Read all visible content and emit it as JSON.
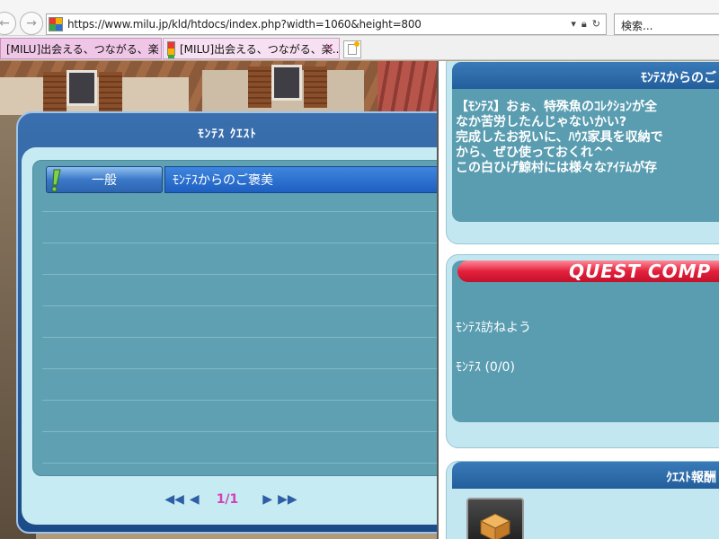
{
  "browser": {
    "url": "https://www.milu.jp/kld/htdocs/index.php?width=1060&height=800",
    "search_placeholder": "検索...",
    "tabs": [
      {
        "label": "[MILU]出会える、つながる、楽しめ..."
      },
      {
        "label": "[MILU]出会える、つながる、楽..."
      }
    ],
    "close_glyph": "×"
  },
  "quest_window": {
    "title": "ﾓﾝﾃｽ ｸｴｽﾄ",
    "items": [
      {
        "category": "一般",
        "name": "ﾓﾝﾃｽからのご褒美"
      }
    ],
    "pager": {
      "first": "◀◀",
      "prev": "◀",
      "page": "1/1",
      "next": "▶",
      "last": "▶▶"
    }
  },
  "dialog": {
    "title": "ﾓﾝﾃｽからのご",
    "text": "【ﾓﾝﾃｽ】おぉ、特殊魚のｺﾚｸｼｮﾝが全\nなか苦労したんじゃないかい?\n完成したお祝いに、ﾊｳｽ家具を収納で\nから、ぜひ使っておくれ^^\nこの白ひげ鯨村には様々なｱｲﾃﾑが存"
  },
  "status": {
    "banner": "QUEST COMP",
    "objective": "ﾓﾝﾃｽ訪ねよう",
    "progress": "ﾓﾝﾃｽ (0/0)"
  },
  "reward": {
    "title": "ｸｴｽﾄ報酬"
  },
  "colors": {
    "tab_active": "#f0c6e6",
    "quest_frame": "#2a5d9e",
    "list_bg": "#5fa1b2",
    "banner_red": "#e4203c",
    "pager_page": "#d43fb6"
  }
}
